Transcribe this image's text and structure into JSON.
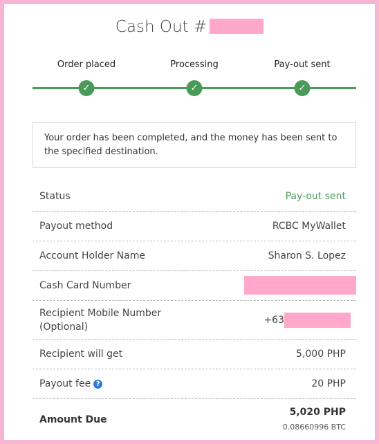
{
  "title": {
    "text": "Cash Out",
    "hash": "#"
  },
  "colors": {
    "border": "#f7b4d3",
    "accent_green": "#4a9a59",
    "redaction": "#ffa8cc",
    "help_icon": "#2c7bd6"
  },
  "steps": [
    {
      "label": "Order placed",
      "icon": "check-icon",
      "check": "✓"
    },
    {
      "label": "Processing",
      "icon": "check-icon",
      "check": "✓"
    },
    {
      "label": "Pay-out sent",
      "icon": "check-icon",
      "check": "✓"
    }
  ],
  "notice": "Your order has been completed, and the money has been sent to the specified destination.",
  "details": {
    "status": {
      "label": "Status",
      "value": "Pay-out sent"
    },
    "payout_method": {
      "label": "Payout method",
      "value": "RCBC MyWallet"
    },
    "account_holder": {
      "label": "Account Holder Name",
      "value": "Sharon S. Lopez"
    },
    "cash_card": {
      "label": "Cash Card Number",
      "value": ""
    },
    "mobile": {
      "label_line1": "Recipient Mobile Number",
      "label_line2": "(Optional)",
      "prefix": "+63"
    },
    "recipient_gets": {
      "label": "Recipient will get",
      "value": "5,000 PHP"
    },
    "payout_fee": {
      "label": "Payout fee",
      "help": "?",
      "value": "20 PHP"
    },
    "amount_due": {
      "label": "Amount Due",
      "php": "5,020 PHP",
      "btc": "0.08660996 BTC"
    }
  }
}
